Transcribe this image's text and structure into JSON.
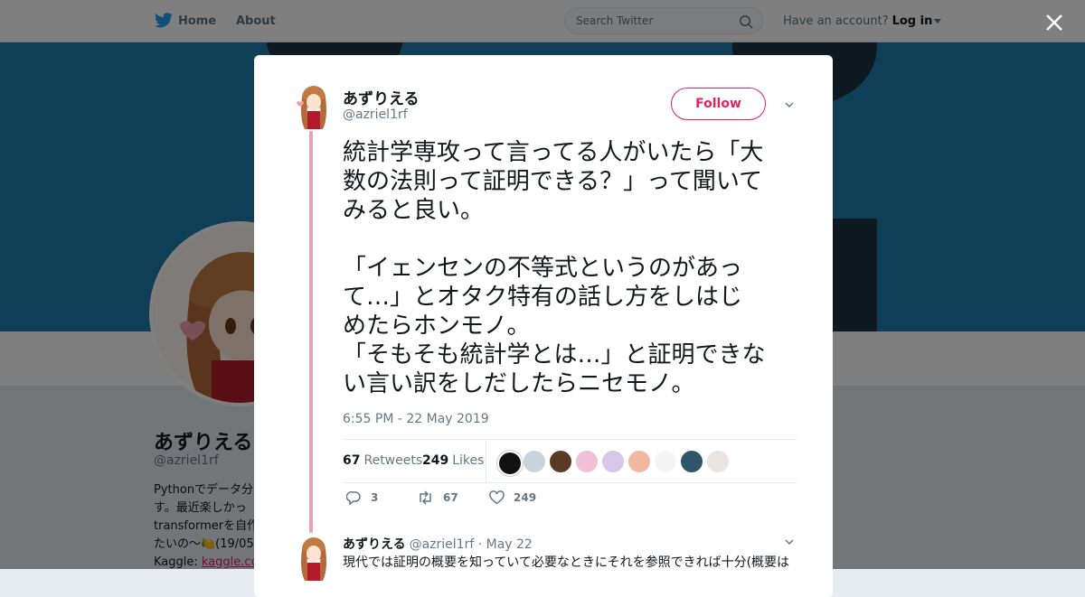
{
  "nav": {
    "home_label": "Home",
    "about_label": "About",
    "search_placeholder": "Search Twitter",
    "have_account": "Have an account?",
    "login_label": "Log in",
    "brand_color": "#1da1f2"
  },
  "profile": {
    "name": "あずりえる",
    "handle": "@azriel1rf",
    "bio_lines": [
      "Pythonでデータ分",
      "す。最近楽しかっ",
      "transformerを自作",
      "たいの〜🍋(19/05"
    ],
    "kaggle_label": "Kaggle:",
    "kaggle_link": "kaggle.co"
  },
  "tweet": {
    "name": "あずりえる",
    "handle": "@azriel1rf",
    "follow_label": "Follow",
    "text": "統計学専攻って言ってる人がいたら「大\n数の法則って証明できる？」って聞いて\nみると良い。\n\n「イェンセンの不等式というのがあっ\nて…」とオタク特有の話し方をしはじ\nめたらホンモノ。\n「そもそも統計学とは…」と証明できな\nい言い訳をしだしたらニセモノ。",
    "timestamp": "6:55 PM - 22 May 2019",
    "retweets_count": "67",
    "retweets_label": "Retweets",
    "likes_count": "249",
    "likes_label": "Likes",
    "actions": {
      "reply": "3",
      "retweet": "67",
      "like": "249"
    },
    "accent_color": "#e0245e"
  },
  "reply": {
    "name": "あずりえる",
    "handle": "@azriel1rf",
    "date": "· May 22",
    "text": "現代では証明の概要を知っていて必要なときにそれを参照できれば十分(概要は"
  }
}
